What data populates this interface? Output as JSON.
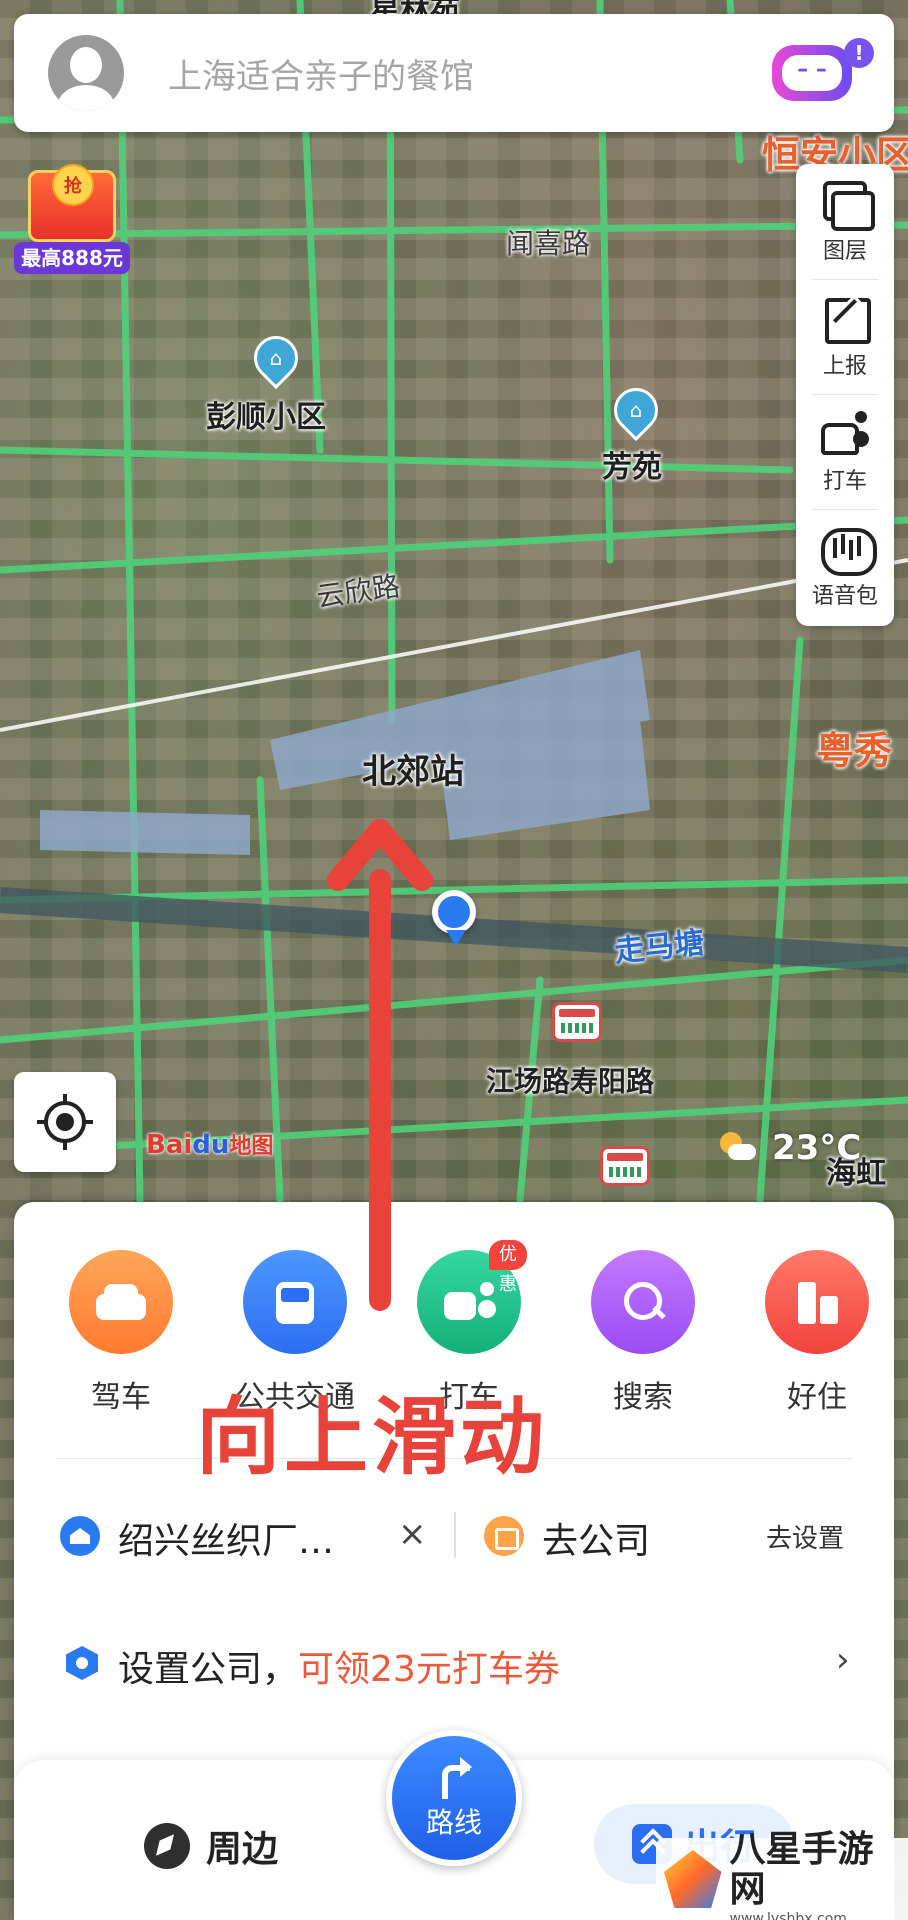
{
  "search": {
    "placeholder": "上海适合亲子的餐馆",
    "notification": "!"
  },
  "promo": {
    "coin_text": "抢",
    "tag": "最高888元"
  },
  "tools": [
    {
      "label": "图层",
      "icon": "layers-icon"
    },
    {
      "label": "上报",
      "icon": "report-edit-icon"
    },
    {
      "label": "打车",
      "icon": "taxi-icon"
    },
    {
      "label": "语音包",
      "icon": "voice-pack-icon"
    }
  ],
  "map": {
    "labels": {
      "xinglin": "星林苑",
      "hengan": "恒安小区",
      "wenxi_road": "闻喜路",
      "pengshun": "彭顺小区",
      "fangyuan": "芳苑",
      "yunxin_road": "云欣路",
      "beijiao_station": "北郊站",
      "yuexiu": "粤秀",
      "zoumatang": "走马塘",
      "jiangchang_stop": "江场路寿阳路",
      "haihong": "海虹"
    },
    "baidu_logo": {
      "bai": "Bai",
      "du": "du",
      "map": "地图"
    },
    "weather_temp": "23°C"
  },
  "quick_actions": [
    {
      "label": "驾车",
      "icon": "car-icon",
      "color": "#ff7b30"
    },
    {
      "label": "公共交通",
      "icon": "bus-icon",
      "color": "#2d6ef2"
    },
    {
      "label": "打车",
      "icon": "taxi-icon",
      "color": "#14b07a",
      "badge": "优惠"
    },
    {
      "label": "搜索",
      "icon": "search-icon",
      "color": "#9a4cf2"
    },
    {
      "label": "好住",
      "icon": "hotel-icon",
      "color": "#f2433c"
    }
  ],
  "addresses": {
    "home": "绍兴丝织厂…",
    "clear": "×",
    "work": "去公司",
    "setup": "去设置"
  },
  "company_promo": {
    "text": "设置公司，",
    "highlight": "可领23元打车券",
    "arrow": "›"
  },
  "tabbar": {
    "nearby": "周边",
    "route": "路线",
    "travel": "出行"
  },
  "annotation": {
    "swipe_text": "向上滑动",
    "color": "#e8433a"
  },
  "watermark": {
    "name": "八星手游网",
    "url": "www.lyshbx.com"
  }
}
